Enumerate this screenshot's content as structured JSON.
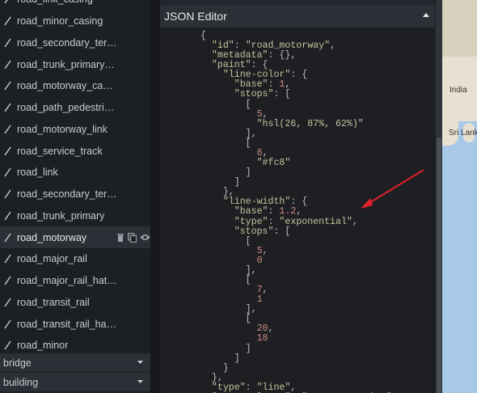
{
  "layers": [
    {
      "label": "road_link_casing",
      "selected": false
    },
    {
      "label": "road_minor_casing",
      "selected": false
    },
    {
      "label": "road_secondary_ter…",
      "selected": false
    },
    {
      "label": "road_trunk_primary…",
      "selected": false
    },
    {
      "label": "road_motorway_ca…",
      "selected": false
    },
    {
      "label": "road_path_pedestri…",
      "selected": false
    },
    {
      "label": "road_motorway_link",
      "selected": false
    },
    {
      "label": "road_service_track",
      "selected": false
    },
    {
      "label": "road_link",
      "selected": false
    },
    {
      "label": "road_secondary_ter…",
      "selected": false
    },
    {
      "label": "road_trunk_primary",
      "selected": false
    },
    {
      "label": "road_motorway",
      "selected": true
    },
    {
      "label": "road_major_rail",
      "selected": false
    },
    {
      "label": "road_major_rail_hat…",
      "selected": false
    },
    {
      "label": "road_transit_rail",
      "selected": false
    },
    {
      "label": "road_transit_rail_ha…",
      "selected": false
    },
    {
      "label": "road_minor",
      "selected": false
    }
  ],
  "layer_icon": "line-layer-icon",
  "selected_layer_actions": [
    "delete-icon",
    "duplicate-icon",
    "visibility-icon"
  ],
  "groups": [
    {
      "label": "bridge",
      "icon": "chevron-down-icon"
    },
    {
      "label": "building",
      "icon": "chevron-down-icon"
    }
  ],
  "editor": {
    "title": "JSON Editor",
    "collapse_icon": "chevron-up-icon",
    "lines": [
      [
        [
          "p",
          "{"
        ]
      ],
      [
        [
          "p",
          "  "
        ],
        [
          "k",
          "\"id\""
        ],
        [
          "p",
          ": "
        ],
        [
          "s",
          "\"road_motorway\""
        ],
        [
          "p",
          ","
        ]
      ],
      [
        [
          "p",
          "  "
        ],
        [
          "k",
          "\"metadata\""
        ],
        [
          "p",
          ": {},"
        ]
      ],
      [
        [
          "p",
          "  "
        ],
        [
          "k",
          "\"paint\""
        ],
        [
          "p",
          ": {"
        ]
      ],
      [
        [
          "p",
          "    "
        ],
        [
          "k",
          "\"line-color\""
        ],
        [
          "p",
          ": {"
        ]
      ],
      [
        [
          "p",
          "      "
        ],
        [
          "k",
          "\"base\""
        ],
        [
          "p",
          ": "
        ],
        [
          "n",
          "1"
        ],
        [
          "p",
          ","
        ]
      ],
      [
        [
          "p",
          "      "
        ],
        [
          "k",
          "\"stops\""
        ],
        [
          "p",
          ": ["
        ]
      ],
      [
        [
          "p",
          "        ["
        ]
      ],
      [
        [
          "p",
          "          "
        ],
        [
          "n",
          "5"
        ],
        [
          "p",
          ","
        ]
      ],
      [
        [
          "p",
          "          "
        ],
        [
          "s",
          "\"hsl(26, 87%, 62%)\""
        ]
      ],
      [
        [
          "p",
          "        ],"
        ]
      ],
      [
        [
          "p",
          "        ["
        ]
      ],
      [
        [
          "p",
          "          "
        ],
        [
          "n",
          "6"
        ],
        [
          "p",
          ","
        ]
      ],
      [
        [
          "p",
          "          "
        ],
        [
          "s",
          "\"#fc8\""
        ]
      ],
      [
        [
          "p",
          "        ]"
        ]
      ],
      [
        [
          "p",
          "      ]"
        ]
      ],
      [
        [
          "p",
          "    },"
        ]
      ],
      [
        [
          "p",
          "    "
        ],
        [
          "k",
          "\"line-width\""
        ],
        [
          "p",
          ": {"
        ]
      ],
      [
        [
          "p",
          "      "
        ],
        [
          "k",
          "\"base\""
        ],
        [
          "p",
          ": "
        ],
        [
          "n",
          "1.2"
        ],
        [
          "p",
          ","
        ]
      ],
      [
        [
          "p",
          "      "
        ],
        [
          "k",
          "\"type\""
        ],
        [
          "p",
          ": "
        ],
        [
          "s",
          "\"exponential\""
        ],
        [
          "p",
          ","
        ]
      ],
      [
        [
          "p",
          "      "
        ],
        [
          "k",
          "\"stops\""
        ],
        [
          "p",
          ": ["
        ]
      ],
      [
        [
          "p",
          "        ["
        ]
      ],
      [
        [
          "p",
          "          "
        ],
        [
          "n",
          "5"
        ],
        [
          "p",
          ","
        ]
      ],
      [
        [
          "p",
          "          "
        ],
        [
          "n",
          "0"
        ]
      ],
      [
        [
          "p",
          "        ],"
        ]
      ],
      [
        [
          "p",
          "        ["
        ]
      ],
      [
        [
          "p",
          "          "
        ],
        [
          "n",
          "7"
        ],
        [
          "p",
          ","
        ]
      ],
      [
        [
          "p",
          "          "
        ],
        [
          "n",
          "1"
        ]
      ],
      [
        [
          "p",
          "        ],"
        ]
      ],
      [
        [
          "p",
          "        ["
        ]
      ],
      [
        [
          "p",
          "          "
        ],
        [
          "n",
          "20"
        ],
        [
          "p",
          ","
        ]
      ],
      [
        [
          "p",
          "          "
        ],
        [
          "n",
          "18"
        ]
      ],
      [
        [
          "p",
          "        ]"
        ]
      ],
      [
        [
          "p",
          "      ]"
        ]
      ],
      [
        [
          "p",
          "    }"
        ]
      ],
      [
        [
          "p",
          "  },"
        ]
      ],
      [
        [
          "p",
          "  "
        ],
        [
          "k",
          "\"type\""
        ],
        [
          "p",
          ": "
        ],
        [
          "s",
          "\"line\""
        ],
        [
          "p",
          ","
        ]
      ],
      [
        [
          "p",
          "  "
        ],
        [
          "k",
          "\"source-layer\""
        ],
        [
          "p",
          ": "
        ],
        [
          "s",
          "\"transportation\""
        ],
        [
          "p",
          ","
        ]
      ]
    ]
  },
  "colors": {
    "key": "#c3c49c",
    "number": "#d08b82",
    "arrow": "#e0202a",
    "selected_row": "#2b2f36"
  },
  "map": {
    "labels": [
      "India",
      "Sri Lanka"
    ]
  }
}
